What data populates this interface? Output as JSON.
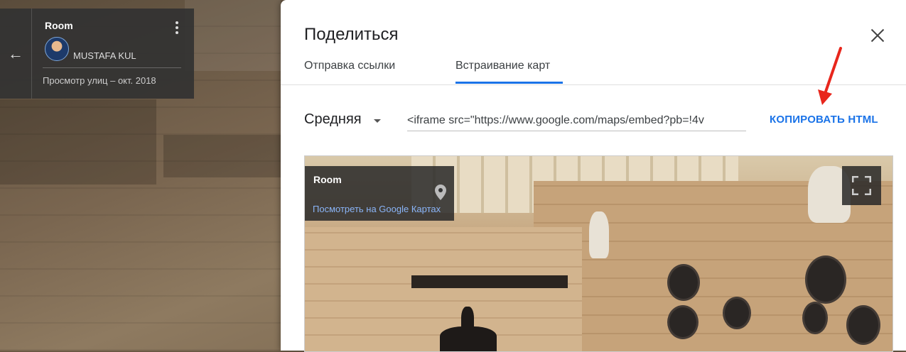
{
  "location_card": {
    "title": "Room",
    "author": "MUSTAFA KUL",
    "date": "Просмотр улиц – окт. 2018",
    "back_icon": "arrow-left-icon",
    "more_icon": "more-vert-icon"
  },
  "dialog": {
    "title": "Поделиться",
    "close_icon": "close-icon",
    "tabs": [
      {
        "label": "Отправка ссылки",
        "active": false
      },
      {
        "label": "Встраивание карт",
        "active": true
      }
    ],
    "size_select": {
      "value": "Средняя"
    },
    "embed_code": "<iframe src=\"https://www.google.com/maps/embed?pb=!4v",
    "copy_label": "КОПИРОВАТЬ HTML",
    "accent_color": "#1a73e8"
  },
  "preview": {
    "title": "Room",
    "link": "Посмотреть на Google Картах",
    "pin_icon": "map-pin-icon",
    "fullscreen_icon": "fullscreen-icon"
  },
  "annotation": {
    "arrow_color": "#e8261c"
  }
}
